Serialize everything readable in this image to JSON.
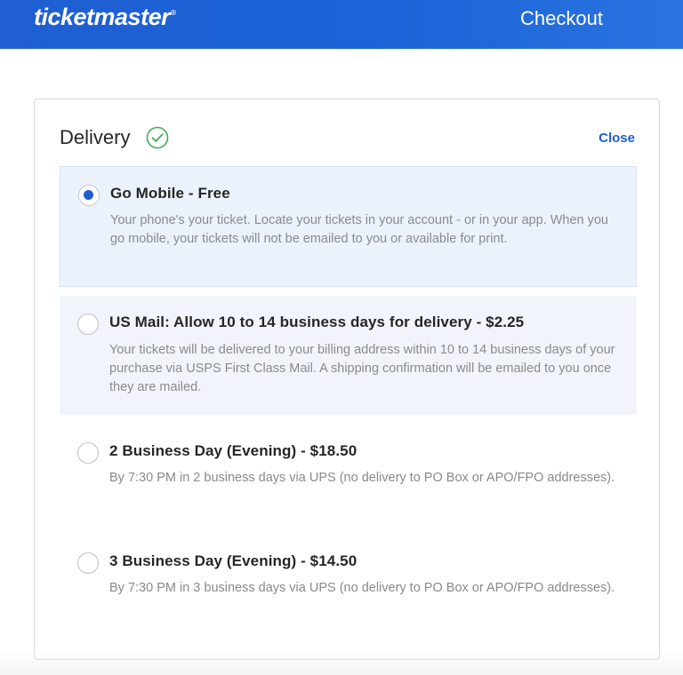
{
  "header": {
    "logo": "ticketmaster",
    "logo_mark": "®",
    "title": "Checkout"
  },
  "delivery": {
    "heading": "Delivery",
    "check_icon": "check-circle-icon",
    "close_label": "Close",
    "options": [
      {
        "title": "Go Mobile - Free",
        "description": "Your phone's your ticket. Locate your tickets in your account - or in your app. When you go mobile, your tickets will not be emailed to you or available for print.",
        "selected": true
      },
      {
        "title": "US Mail: Allow 10 to 14 business days for delivery - $2.25",
        "description": "Your tickets will be delivered to your billing address within 10 to 14 business days of your purchase via USPS First Class Mail. A shipping confirmation will be emailed to you once they are mailed.",
        "selected": false
      },
      {
        "title": "2 Business Day (Evening) - $18.50",
        "description": "By 7:30 PM in 2 business days via UPS (no delivery to PO Box or APO/FPO addresses).",
        "selected": false
      },
      {
        "title": "3 Business Day (Evening) - $14.50",
        "description": "By 7:30 PM in 3 business days via UPS (no delivery to PO Box or APO/FPO addresses).",
        "selected": false
      }
    ]
  },
  "colors": {
    "brand_blue": "#1f5fd1",
    "selected_bg": "#ebf2fc",
    "success_green": "#3fae5a"
  }
}
